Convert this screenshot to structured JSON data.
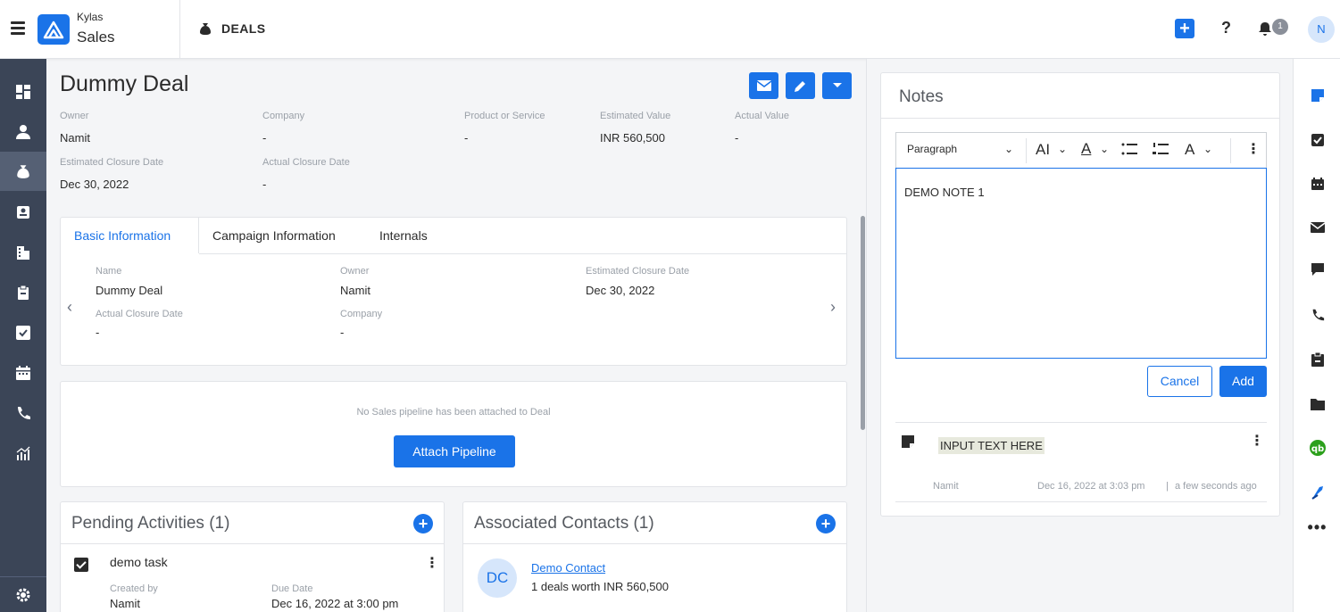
{
  "app": {
    "brand_top": "Kylas",
    "brand_bottom": "Sales",
    "module": "DEALS"
  },
  "top": {
    "notification_count": "1",
    "avatar_initial": "N",
    "help": "?"
  },
  "deal": {
    "title": "Dummy Deal",
    "fields": [
      {
        "label": "Owner",
        "value": "Namit"
      },
      {
        "label": "Company",
        "value": "-"
      },
      {
        "label": "Product or Service",
        "value": "-"
      },
      {
        "label": "Estimated Value",
        "value": "INR 560,500"
      },
      {
        "label": "Actual Value",
        "value": "-"
      },
      {
        "label": "Estimated Closure Date",
        "value": "Dec 30, 2022"
      },
      {
        "label": "Actual Closure Date",
        "value": "-"
      }
    ]
  },
  "tabs": [
    "Basic Information",
    "Campaign Information",
    "Internals"
  ],
  "basic_info": [
    {
      "label": "Name",
      "value": "Dummy Deal"
    },
    {
      "label": "Owner",
      "value": "Namit"
    },
    {
      "label": "Estimated Closure Date",
      "value": "Dec 30, 2022"
    },
    {
      "label": "Actual Closure Date",
      "value": "-"
    },
    {
      "label": "Company",
      "value": "-"
    }
  ],
  "pipeline": {
    "message": "No Sales pipeline has been attached to Deal",
    "button": "Attach Pipeline"
  },
  "activities": {
    "title": "Pending Activities (1)",
    "item": {
      "name": "demo task",
      "created_label": "Created by",
      "created_value": "Namit",
      "due_label": "Due Date",
      "due_value": "Dec 16, 2022 at 3:00 pm"
    }
  },
  "contacts": {
    "title": "Associated Contacts (1)",
    "item": {
      "initials": "DC",
      "name": "Demo Contact",
      "summary": "1 deals worth INR 560,500"
    }
  },
  "notes": {
    "title": "Notes",
    "toolbar": {
      "paragraph": "Paragraph",
      "font_size": "AI",
      "font_color": "A"
    },
    "editor_text": "DEMO NOTE 1",
    "cancel": "Cancel",
    "add": "Add",
    "note": {
      "text": "INPUT TEXT HERE",
      "author": "Namit",
      "timestamp": "Dec 16, 2022 at 3:03 pm",
      "relative": "a few seconds ago"
    }
  }
}
